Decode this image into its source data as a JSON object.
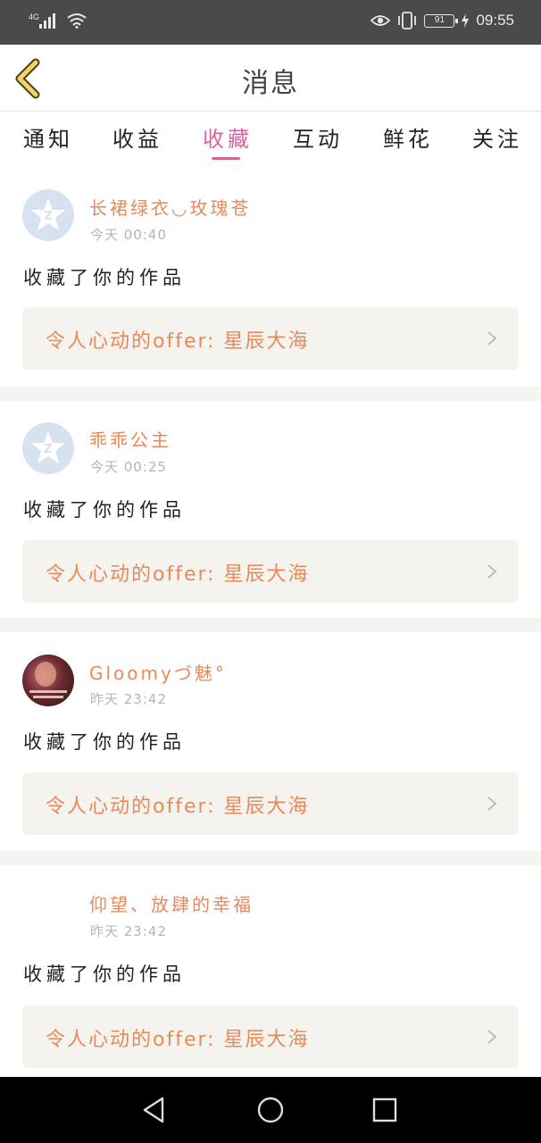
{
  "status_bar": {
    "network": "4G",
    "battery": "91",
    "time": "09:55"
  },
  "header": {
    "title": "消息"
  },
  "tabs": [
    {
      "label": "通知",
      "active": false
    },
    {
      "label": "收益",
      "active": false
    },
    {
      "label": "收藏",
      "active": true
    },
    {
      "label": "互动",
      "active": false
    },
    {
      "label": "鲜花",
      "active": false
    },
    {
      "label": "关注",
      "active": false
    }
  ],
  "messages": [
    {
      "user": "长裙绿衣◡玫瑰苍",
      "time": "今天 00:40",
      "action": "收藏了你的作品",
      "work": "令人心动的offer: 星辰大海",
      "avatar": "default-avatar"
    },
    {
      "user": "乖乖公主",
      "time": "今天 00:25",
      "action": "收藏了你的作品",
      "work": "令人心动的offer: 星辰大海",
      "avatar": "default-avatar"
    },
    {
      "user": "Gloomyづ魅°",
      "time": "昨天 23:42",
      "action": "收藏了你的作品",
      "work": "令人心动的offer: 星辰大海",
      "avatar": "photo-avatar"
    },
    {
      "user": "仰望、放肆的幸福",
      "time": "昨天 23:42",
      "action": "收藏了你的作品",
      "work": "令人心动的offer: 星辰大海",
      "avatar": "blank-avatar"
    }
  ],
  "colors": {
    "accent": "#d9639e",
    "username": "#e8895a",
    "card_bg": "#f4f3ee",
    "status_bar": "#4a4a4a"
  }
}
